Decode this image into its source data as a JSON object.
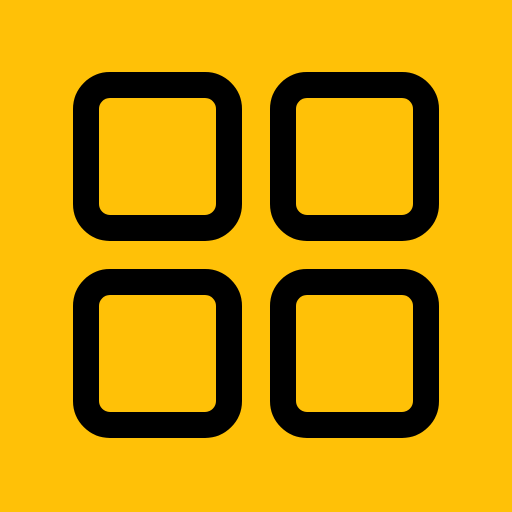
{
  "icon": {
    "name": "grid-icon",
    "cells": [
      "top-left",
      "top-right",
      "bottom-left",
      "bottom-right"
    ]
  },
  "colors": {
    "background": "#FFC107",
    "stroke": "#000000"
  }
}
